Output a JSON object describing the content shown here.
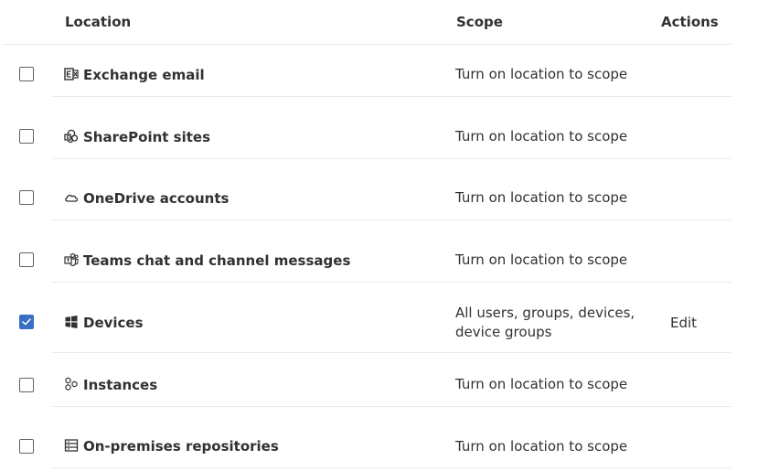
{
  "header": {
    "location": "Location",
    "scope": "Scope",
    "actions": "Actions"
  },
  "rows": [
    {
      "name": "Exchange email",
      "icon": "exchange-icon",
      "checked": false,
      "scope": "Turn on location to scope",
      "action": ""
    },
    {
      "name": "SharePoint sites",
      "icon": "sharepoint-icon",
      "checked": false,
      "scope": "Turn on location to scope",
      "action": ""
    },
    {
      "name": "OneDrive accounts",
      "icon": "onedrive-icon",
      "checked": false,
      "scope": "Turn on location to scope",
      "action": ""
    },
    {
      "name": "Teams chat and channel messages",
      "icon": "teams-icon",
      "checked": false,
      "scope": "Turn on location to scope",
      "action": ""
    },
    {
      "name": "Devices",
      "icon": "windows-icon",
      "checked": true,
      "scope": "All users, groups, devices, device groups",
      "action": "Edit"
    },
    {
      "name": "Instances",
      "icon": "instances-icon",
      "checked": false,
      "scope": "Turn on location to scope",
      "action": ""
    },
    {
      "name": "On-premises repositories",
      "icon": "repository-icon",
      "checked": false,
      "scope": "Turn on location to scope",
      "action": ""
    }
  ],
  "colors": {
    "checked": "#3a6fc4",
    "text": "#323130",
    "divider": "#ebebeb"
  }
}
